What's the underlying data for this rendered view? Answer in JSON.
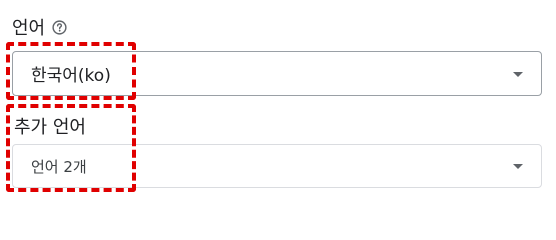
{
  "language": {
    "label": "언어",
    "help_icon": "help-circle-icon",
    "selected_value": "한국어(ko)",
    "dropdown_icon": "arrow-drop-down-icon"
  },
  "additional_languages": {
    "label": "추가 언어",
    "selected_value": "언어 2개",
    "dropdown_icon": "arrow-drop-down-icon"
  },
  "colors": {
    "highlight": "#e00000",
    "border": "#9aa0a6",
    "text": "#202124"
  }
}
